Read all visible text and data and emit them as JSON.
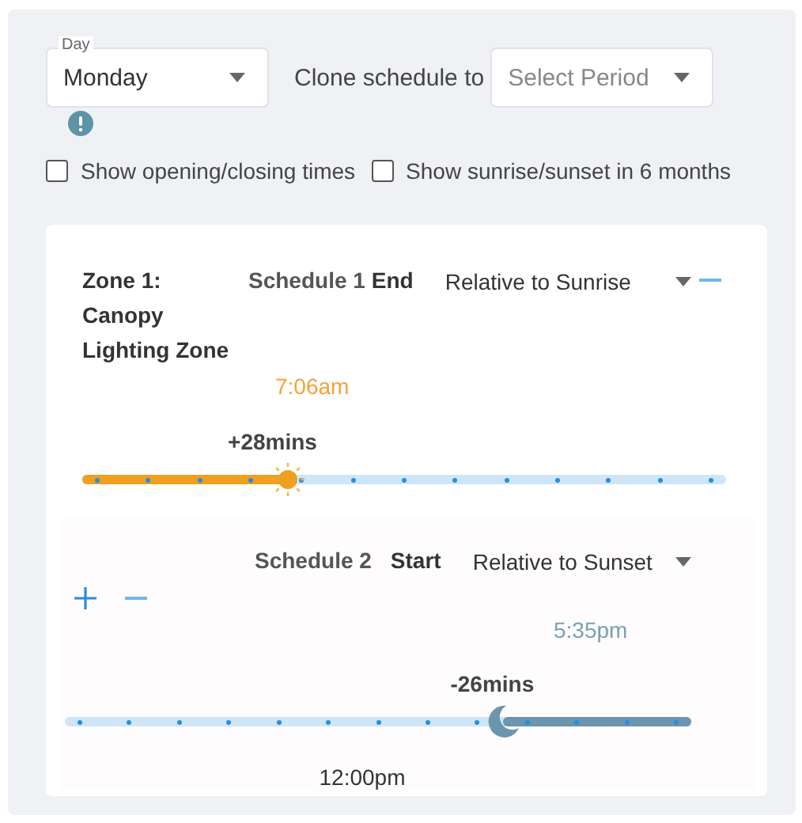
{
  "day_select": {
    "label": "Day",
    "value": "Monday"
  },
  "clone": {
    "label": "Clone schedule to",
    "placeholder": "Select Period"
  },
  "checkboxes": [
    {
      "label": "Show opening/closing times",
      "checked": false
    },
    {
      "label": "Show sunrise/sunset in 6 months",
      "checked": false
    }
  ],
  "zone": {
    "name": "Zone 1: Canopy Lighting Zone"
  },
  "schedules": [
    {
      "title": "Schedule 1",
      "event": "End",
      "mode": "Relative to Sunrise",
      "kind": "sunrise",
      "time": "7:06am",
      "offset": "+28mins",
      "level": 0.32,
      "actions": [
        {
          "kind": "remove"
        }
      ]
    },
    {
      "title": "Schedule 2",
      "event": "Start",
      "mode": "Relative to Sunset",
      "kind": "sunset",
      "time": "5:35pm",
      "offset": "-26mins",
      "level": 0.7,
      "actions": [
        {
          "kind": "add"
        },
        {
          "kind": "remove"
        }
      ],
      "footer": "12:00pm"
    }
  ]
}
